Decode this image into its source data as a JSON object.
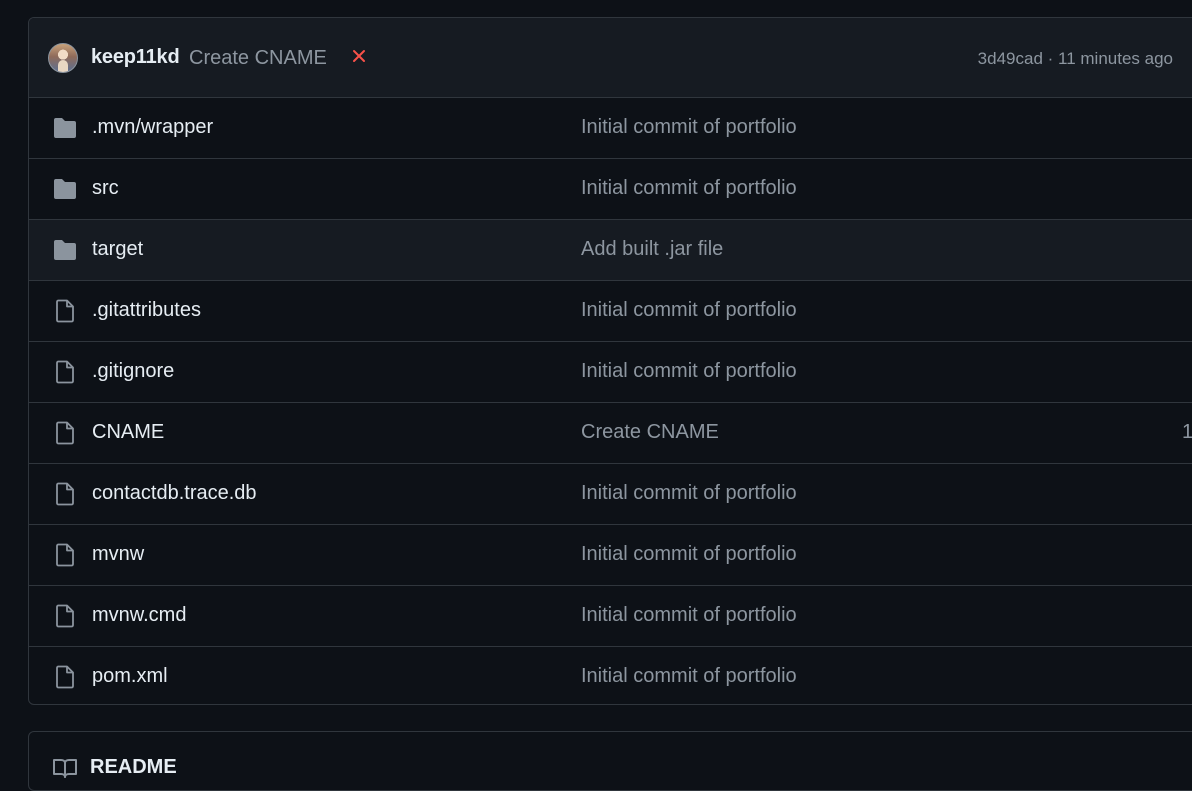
{
  "latest_commit": {
    "author": "keep11kd",
    "message": "Create CNAME",
    "status": "failure",
    "status_icon": "x-icon",
    "status_color": "#f85149",
    "meta": "3d49cad · 11 minutes ago"
  },
  "files": [
    {
      "type": "folder",
      "icon": "folder-icon",
      "name": ".mvn/wrapper",
      "message": "Initial commit of portfolio",
      "date": ""
    },
    {
      "type": "folder",
      "icon": "folder-icon",
      "name": "src",
      "message": "Initial commit of portfolio",
      "date": ""
    },
    {
      "type": "folder",
      "icon": "folder-icon",
      "name": "target",
      "message": "Add built .jar file",
      "date": ""
    },
    {
      "type": "file",
      "icon": "file-icon",
      "name": ".gitattributes",
      "message": "Initial commit of portfolio",
      "date": ""
    },
    {
      "type": "file",
      "icon": "file-icon",
      "name": ".gitignore",
      "message": "Initial commit of portfolio",
      "date": ""
    },
    {
      "type": "file",
      "icon": "file-icon",
      "name": "CNAME",
      "message": "Create CNAME",
      "date": "1"
    },
    {
      "type": "file",
      "icon": "file-icon",
      "name": "contactdb.trace.db",
      "message": "Initial commit of portfolio",
      "date": ""
    },
    {
      "type": "file",
      "icon": "file-icon",
      "name": "mvnw",
      "message": "Initial commit of portfolio",
      "date": ""
    },
    {
      "type": "file",
      "icon": "file-icon",
      "name": "mvnw.cmd",
      "message": "Initial commit of portfolio",
      "date": ""
    },
    {
      "type": "file",
      "icon": "file-icon",
      "name": "pom.xml",
      "message": "Initial commit of portfolio",
      "date": ""
    }
  ],
  "readme": {
    "icon": "book-icon",
    "label": "README"
  },
  "colors": {
    "background": "#0d1117",
    "header_bg": "#161b22",
    "border": "#30363d",
    "text": "#e6edf3",
    "muted": "#8d96a0",
    "folder": "#8b949e"
  }
}
